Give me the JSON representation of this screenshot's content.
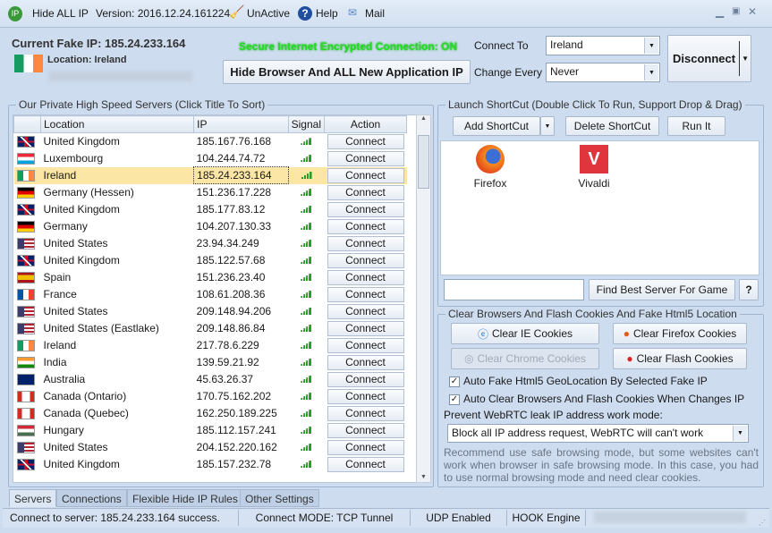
{
  "title": {
    "app": "Hide ALL IP",
    "version": "Version: 2016.12.24.161224",
    "unactive": "UnActive",
    "help": "Help",
    "mail": "Mail"
  },
  "header": {
    "current_ip": "Current Fake IP: 185.24.233.164",
    "location": "Location: Ireland",
    "secure": "Secure Internet Encrypted Connection: ON",
    "hide_btn": "Hide Browser And ALL New Application IP",
    "connect_to_label": "Connect To",
    "connect_to_value": "Ireland",
    "change_every_label": "Change Every",
    "change_every_value": "Never",
    "disconnect": "Disconnect"
  },
  "servers": {
    "title": "Our Private High Speed Servers (Click Title To Sort)",
    "columns": [
      "Location",
      "IP",
      "Signal",
      "Action"
    ],
    "rows": [
      {
        "flag": "uk",
        "location": "United Kingdom",
        "ip": "185.167.76.168"
      },
      {
        "flag": "lu",
        "location": "Luxembourg",
        "ip": "104.244.74.72"
      },
      {
        "flag": "ie",
        "location": "Ireland",
        "ip": "185.24.233.164",
        "selected": true
      },
      {
        "flag": "de",
        "location": "Germany (Hessen)",
        "ip": "151.236.17.228"
      },
      {
        "flag": "uk",
        "location": "United Kingdom",
        "ip": "185.177.83.12"
      },
      {
        "flag": "de",
        "location": "Germany",
        "ip": "104.207.130.33"
      },
      {
        "flag": "us",
        "location": "United States",
        "ip": "23.94.34.249"
      },
      {
        "flag": "uk",
        "location": "United Kingdom",
        "ip": "185.122.57.68"
      },
      {
        "flag": "es",
        "location": "Spain",
        "ip": "151.236.23.40"
      },
      {
        "flag": "fr",
        "location": "France",
        "ip": "108.61.208.36"
      },
      {
        "flag": "us",
        "location": "United States",
        "ip": "209.148.94.206"
      },
      {
        "flag": "us",
        "location": "United States (Eastlake)",
        "ip": "209.148.86.84"
      },
      {
        "flag": "ie",
        "location": "Ireland",
        "ip": "217.78.6.229"
      },
      {
        "flag": "in",
        "location": "India",
        "ip": "139.59.21.92"
      },
      {
        "flag": "au",
        "location": "Australia",
        "ip": "45.63.26.37"
      },
      {
        "flag": "ca",
        "location": "Canada (Ontario)",
        "ip": "170.75.162.202"
      },
      {
        "flag": "ca",
        "location": "Canada (Quebec)",
        "ip": "162.250.189.225"
      },
      {
        "flag": "hu",
        "location": "Hungary",
        "ip": "185.112.157.241"
      },
      {
        "flag": "us",
        "location": "United States",
        "ip": "204.152.220.162"
      },
      {
        "flag": "uk",
        "location": "United Kingdom",
        "ip": "185.157.232.78"
      }
    ],
    "action_label": "Connect"
  },
  "shortcut": {
    "title": "Launch ShortCut (Double Click To Run, Support Drop & Drag)",
    "add": "Add ShortCut",
    "delete": "Delete ShortCut",
    "run": "Run It",
    "items": [
      "Firefox",
      "Vivaldi"
    ],
    "find_best": "Find Best Server For Game",
    "help": "?"
  },
  "clear": {
    "title": "Clear Browsers And Flash Cookies And Fake Html5 Location",
    "ie": "Clear IE Cookies",
    "firefox": "Clear Firefox Cookies",
    "chrome": "Clear Chrome Cookies",
    "flash": "Clear Flash Cookies",
    "chk1": "Auto Fake Html5 GeoLocation By Selected Fake IP",
    "chk2": "Auto Clear Browsers And Flash Cookies When Changes IP",
    "webrtc_label": "Prevent WebRTC leak IP address work mode:",
    "webrtc_value": "Block all IP address request, WebRTC will can't work",
    "note": "Recommend use safe browsing mode, but some websites can't work when browser in safe browsing mode. In this case, you had to use normal browsing mode and need clear cookies."
  },
  "tabs": [
    "Servers",
    "Connections",
    "Flexible Hide IP Rules",
    "Other Settings"
  ],
  "status": [
    "Connect to server: 185.24.233.164 success.",
    "Connect MODE: TCP Tunnel",
    "UDP Enabled",
    "HOOK Engine"
  ]
}
